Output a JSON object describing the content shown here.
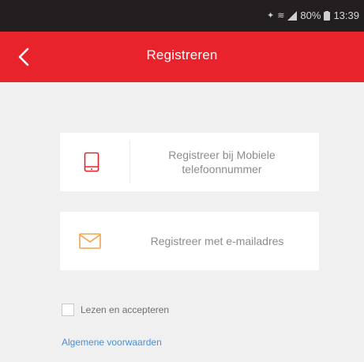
{
  "status_bar": {
    "icons": [
      "notification-icon",
      "wifi-icon",
      "signal-icon",
      "battery-icon"
    ],
    "battery": "80%",
    "time": "13:39"
  },
  "app_bar": {
    "title": "Registreren",
    "back_icon": "chevron-left-icon",
    "color": "#e8232b"
  },
  "options": {
    "phone": {
      "label": "Registreer bij Mobiele telefoonnummer",
      "icon": "phone-icon",
      "icon_color": "#e8232b"
    },
    "email": {
      "label": "Registreer met e-mailadres",
      "icon": "envelope-icon",
      "icon_color": "#f3a24e"
    }
  },
  "consent": {
    "checkbox_checked": false,
    "label": "Lezen en accepteren",
    "terms_link": "Algemene voorwaarden",
    "link_color": "#4a8fd6"
  }
}
